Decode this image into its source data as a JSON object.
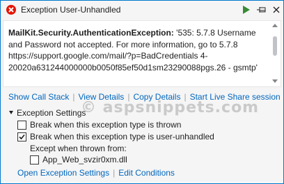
{
  "titlebar": {
    "title": "Exception User-Unhandled",
    "icons": [
      "exception-icon",
      "play-icon",
      "pin-icon",
      "close-icon"
    ]
  },
  "message": {
    "exception_type": "MailKit.Security.AuthenticationException:",
    "body": " '535: 5.7.8 Username and Password not accepted. For more information, go to 5.7.8  https://support.google.com/mail/?p=BadCredentials 4-20020a631244000000b0050f85ef50d1sm23290088pgs.26 - gsmtp'"
  },
  "actions": {
    "show_call_stack": "Show Call Stack",
    "view_details": "View Details",
    "copy_details": "Copy Details",
    "start_live_share": "Start Live Share session",
    "separator": "|"
  },
  "watermark": "© aspsnippets.com",
  "settings": {
    "header": "Exception Settings",
    "break_thrown": {
      "label": "Break when this exception type is thrown",
      "checked": false
    },
    "break_unhandled": {
      "label": "Break when this exception type is user-unhandled",
      "checked": true
    },
    "except_label": "Except when thrown from:",
    "module": {
      "label": "App_Web_svzir0xm.dll",
      "checked": false
    }
  },
  "footer": {
    "open_settings": "Open Exception Settings",
    "edit_conditions": "Edit Conditions",
    "separator": "|"
  },
  "colors": {
    "accent": "#007acc",
    "link": "#0066bf",
    "error": "#e51400",
    "play": "#388a34"
  }
}
